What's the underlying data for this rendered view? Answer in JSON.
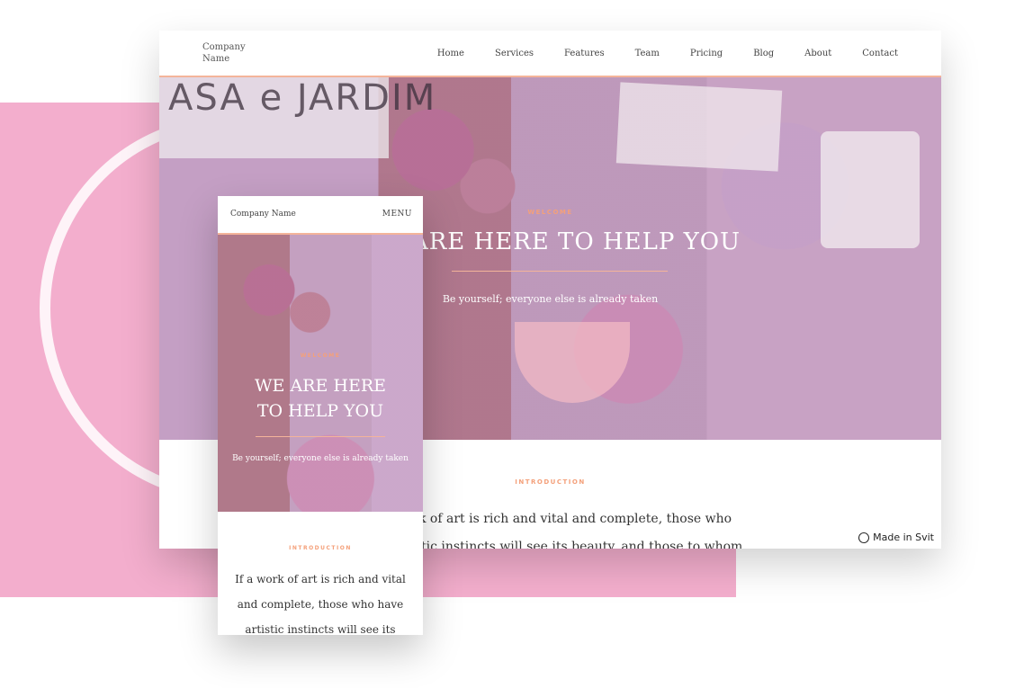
{
  "desktop": {
    "logo": "Company Name",
    "nav": [
      "Home",
      "Services",
      "Features",
      "Team",
      "Pricing",
      "Blog",
      "About",
      "Contact"
    ],
    "hero_background_text": "ASA e JARDIM",
    "welcome": "WELCOME",
    "title": "WE ARE HERE TO HELP YOU",
    "subtitle": "Be yourself; everyone else is already taken",
    "intro_label": "INTRODUCTION",
    "intro_text": "If a work of art is rich and vital and complete, those who have artistic instincts will see its beauty, and those to whom ethics appeal more",
    "badge": "Made in Svit"
  },
  "mobile": {
    "logo": "Company Name",
    "menu": "MENU",
    "welcome": "WELCOME",
    "title": "WE ARE HERE TO HELP YOU",
    "subtitle": "Be yourself; everyone else is already taken",
    "intro_label": "INTRODUCTION",
    "intro_text": "If a work of art is rich and vital and complete, those who have artistic instincts will see its beauty, and"
  },
  "colors": {
    "accent": "#f4a07a",
    "backdrop_pink": "#f3aecd",
    "overlay": "#a868aa"
  }
}
